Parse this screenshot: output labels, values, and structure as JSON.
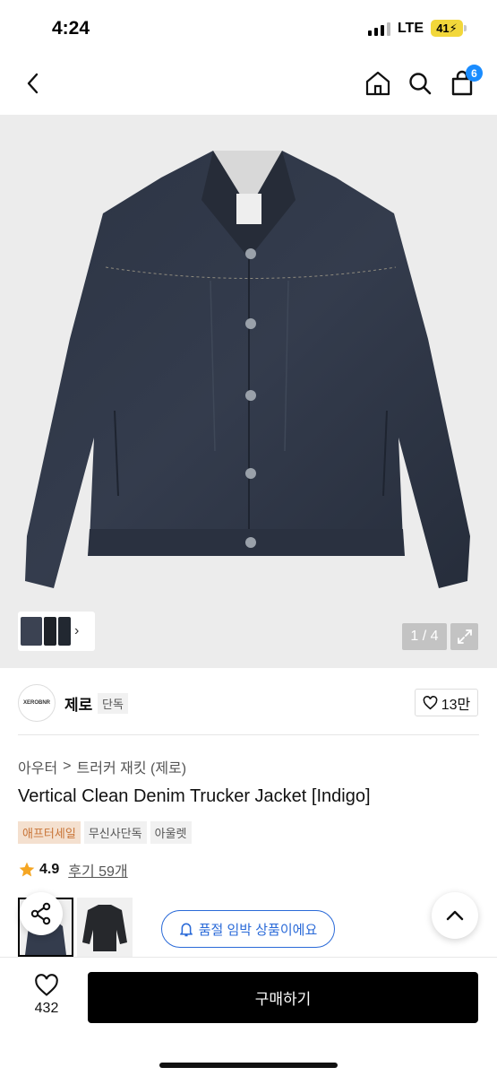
{
  "status_bar": {
    "time": "4:24",
    "network": "LTE",
    "battery": "41"
  },
  "nav": {
    "cart_count": "6",
    "icons": [
      "chevron-left-icon",
      "home-icon",
      "search-icon",
      "shopping-bag-icon"
    ]
  },
  "gallery": {
    "counter": "1 / 4",
    "thumb_arrow": "›"
  },
  "brand": {
    "logo_text": "XEROBNR",
    "name": "제로",
    "tag": "단독",
    "likes": "13만"
  },
  "breadcrumb": {
    "category": "아우터",
    "separator": ">",
    "subcategory": "트러커 재킷 (제로)"
  },
  "product": {
    "title": "Vertical Clean Denim Trucker Jacket [Indigo]",
    "tags": [
      "애프터세일",
      "무신사단독",
      "아울렛"
    ],
    "rating": "4.9",
    "reviews": "후기 59개"
  },
  "notice": {
    "text": "품절 임박 상품이에요"
  },
  "bottom_bar": {
    "wish_count": "432",
    "buy_label": "구매하기"
  },
  "colors": {
    "accent_blue": "#2a6ad8",
    "badge_blue": "#1a8cff",
    "tag_orange": "#c87437",
    "rating_star": "#f5a623"
  }
}
